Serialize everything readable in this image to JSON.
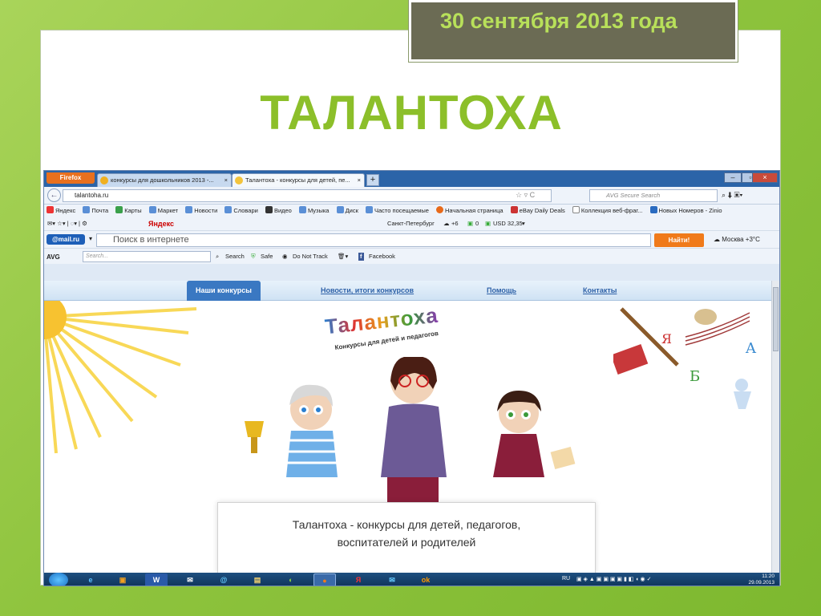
{
  "slide": {
    "date": "30 сентября 2013 года",
    "title": "ТАЛАНТОХА"
  },
  "browser": {
    "firefox_button": "Firefox",
    "tabs": [
      {
        "title": "конкурсы для дошкольников 2013 -..."
      },
      {
        "title": "Талантоха - конкурсы для детей, пе..."
      }
    ],
    "url": "talantoha.ru",
    "avg_search_placeholder": "AVG Secure Search",
    "bookmarks": [
      "Яндекс",
      "Почта",
      "Карты",
      "Маркет",
      "Новости",
      "Словари",
      "Видео",
      "Музыка",
      "Диск",
      "Часто посещаемые",
      "Начальная страница",
      "eBay Daily Deals",
      "Коллекция веб-фраг...",
      "Новых Номеров - Zinio"
    ],
    "yandex_bar": {
      "brand": "Яндекс",
      "city": "Санкт-Петербург",
      "temp": "+6",
      "mail_count": "0",
      "usd": "USD 32,35"
    },
    "mailru": {
      "logo": "@mail.ru",
      "search_placeholder": "Поиск в интернете",
      "find_button": "Найти!",
      "weather": "Москва +3°C"
    },
    "avg_toolbar": {
      "logo": "AVG",
      "search_placeholder": "Search...",
      "search": "Search",
      "safe": "Safe",
      "do_not_track": "Do Not Track",
      "facebook": "Facebook"
    }
  },
  "site": {
    "nav": [
      "Наши конкурсы",
      "Новости, итоги конкурсов",
      "Помощь",
      "Контакты"
    ],
    "logo": "Талантоха",
    "logo_sub": "Конкурсы для детей и педагогов",
    "caption_line1": "Талантоха - конкурсы для детей, педагогов,",
    "caption_line2": "воспитателей и родителей"
  },
  "taskbar": {
    "lang": "RU",
    "time": "11:20",
    "date": "29.09.2013",
    "apps": [
      "ie",
      "media",
      "word",
      "mail-app",
      "mailru-agent",
      "folder",
      "paint",
      "firefox",
      "yandex",
      "outlook",
      "odnoklassniki"
    ]
  },
  "colors": {
    "slide_bg": "#8fc43e",
    "title_green": "#8cbf2a",
    "date_box": "#6b6b54",
    "find_button": "#f07a1a",
    "nav_active": "#3a78c2"
  }
}
